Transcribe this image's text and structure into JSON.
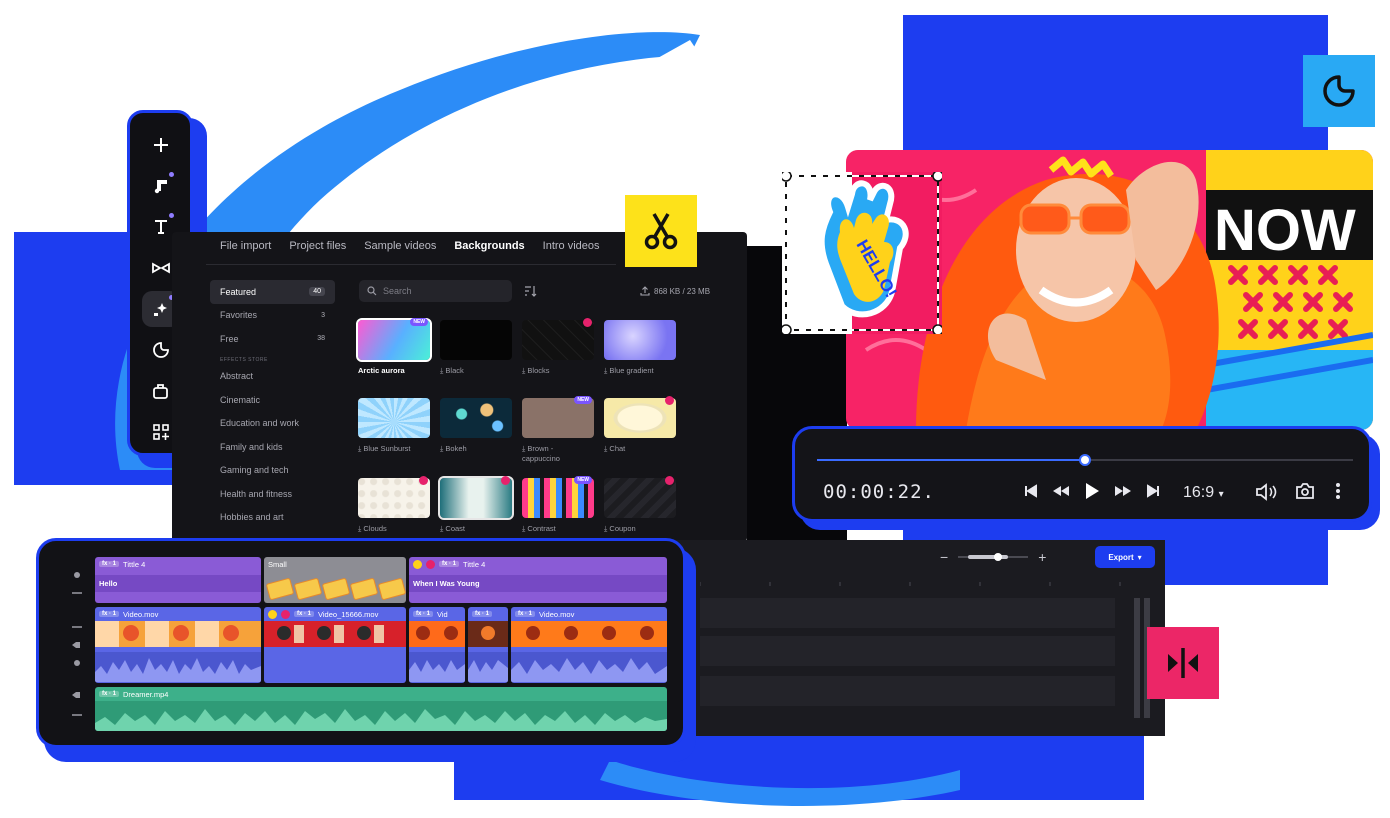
{
  "colors": {
    "brand_blue": "#1d3df0",
    "sky_blue": "#29a9f4",
    "yellow": "#fde21a",
    "pink": "#ec2667",
    "purple_clip": "#8a5bd6",
    "blue_clip": "#5a66e6",
    "green_clip": "#3db08a"
  },
  "tool_rail": {
    "items": [
      {
        "icon": "plus-icon"
      },
      {
        "icon": "music-note-icon"
      },
      {
        "icon": "text-icon"
      },
      {
        "icon": "transitions-icon"
      },
      {
        "icon": "effects-icon"
      },
      {
        "icon": "sticker-icon"
      },
      {
        "icon": "briefcase-add-icon"
      },
      {
        "icon": "apps-add-icon"
      }
    ]
  },
  "media_panel": {
    "tabs": [
      "File import",
      "Project files",
      "Sample videos",
      "Backgrounds",
      "Intro videos"
    ],
    "active_tab": "Backgrounds",
    "categories_top": [
      {
        "label": "Featured",
        "count": "40"
      },
      {
        "label": "Favorites",
        "count": "3"
      },
      {
        "label": "Free",
        "count": "38"
      }
    ],
    "categories_heading": "EFFECTS STORE",
    "categories": [
      "Abstract",
      "Cinematic",
      "Education and work",
      "Family and kids",
      "Gaming and tech",
      "Health and fitness",
      "Hobbies and art"
    ],
    "search_placeholder": "Search",
    "storage": "868 KB / 23 MB",
    "tiles": [
      {
        "label": "Arctic aurora",
        "badge": "NEW"
      },
      {
        "label": "Black",
        "badge": ""
      },
      {
        "label": "Blocks",
        "badge": "crown"
      },
      {
        "label": "Blue gradient",
        "badge": ""
      },
      {
        "label": "Blue Sunburst",
        "badge": ""
      },
      {
        "label": "Bokeh",
        "badge": ""
      },
      {
        "label": "Brown - cappuccino",
        "badge": "NEW"
      },
      {
        "label": "Chat",
        "badge": "crown"
      },
      {
        "label": "Clouds",
        "badge": "crown"
      },
      {
        "label": "Coast",
        "badge": "crown"
      },
      {
        "label": "Contrast",
        "badge": "NEW"
      },
      {
        "label": "Coupon",
        "badge": "crown"
      }
    ]
  },
  "player": {
    "timecode": "00:00:22.",
    "aspect_ratio": "16:9",
    "progress": 0.5
  },
  "timeline": {
    "export_label": "Export",
    "tracks": {
      "title_clips": [
        {
          "label": "Tittle 4",
          "fx": "fx · 1",
          "body": "Hello"
        },
        {
          "label": "Small",
          "fx": "",
          "body": ""
        },
        {
          "label": "Tittle 4",
          "fx": "fx · 1",
          "body": "When I Was Young"
        }
      ],
      "video_clips": [
        {
          "label": "Video.mov",
          "fx": "fx · 1"
        },
        {
          "label": "Video_15666.mov",
          "fx": "fx · 1"
        },
        {
          "label": "Vid",
          "fx": "fx · 1"
        },
        {
          "label": "",
          "fx": "fx · 1"
        },
        {
          "label": "Video.mov",
          "fx": "fx · 1"
        }
      ],
      "audio_clip": {
        "label": "Dreamer.mp4",
        "fx": "fx · 1"
      }
    }
  },
  "sticker": {
    "text": "HELLO!"
  }
}
